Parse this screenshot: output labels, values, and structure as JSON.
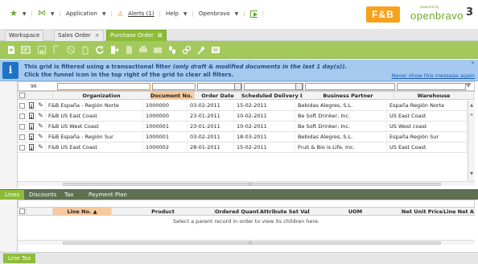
{
  "topnav": {
    "application": "Application",
    "alerts": "Alerts (1)",
    "help": "Help",
    "user": "Openbravo"
  },
  "logo": {
    "fb": "F&B",
    "powered": "powered by",
    "name": "openbravo",
    "version": "3"
  },
  "tabs": [
    {
      "label": "Workspace",
      "closable": false,
      "active": false
    },
    {
      "label": "Sales Order",
      "closable": true,
      "active": false
    },
    {
      "label": "Purchase Order",
      "closable": true,
      "active": true
    }
  ],
  "message": {
    "text_before": "This grid is filtered using a transactional filter ",
    "text_italic": "(only draft & modified documents in the last 1 day(s)).",
    "line2": "Click the funnel icon in the top right of the grid to clear all filters.",
    "link": "Never show this message again",
    "close": "×"
  },
  "filter": {
    "count": "96"
  },
  "grid": {
    "columns": [
      "Organization",
      "Document No. ▲",
      "Order Date",
      "Scheduled Delivery Date",
      "Business Partner",
      "Warehouse"
    ],
    "rows": [
      [
        "F&B España - Región Norte",
        "1000000",
        "03-02-2011",
        "15-02-2011",
        "Bebidas Alegres, S.L.",
        "España Región Norte"
      ],
      [
        "F&B US East Coast",
        "1000000",
        "23-01-2011",
        "10-02-2011",
        "Be Soft Drinker, Inc.",
        "US East Coast"
      ],
      [
        "F&B US West Coast",
        "1000001",
        "23-01-2011",
        "10-02-2011",
        "Be Soft Drinker, Inc.",
        "US West coast"
      ],
      [
        "F&B España - Región Sur",
        "1000001",
        "03-02-2011",
        "18-03-2011",
        "Bebidas Alegres, S.L.",
        "España Región Sur"
      ],
      [
        "F&B US East Coast",
        "1000002",
        "28-01-2011",
        "15-02-2011",
        "Fruit & Bio is Life, Inc.",
        "US East Coast"
      ]
    ]
  },
  "child_tabs": [
    {
      "label": "Lines",
      "active": true
    },
    {
      "label": "Discounts",
      "active": false
    },
    {
      "label": "Tax",
      "active": false
    },
    {
      "label": "Payment Plan",
      "active": false
    }
  ],
  "lines_grid": {
    "columns": [
      "Line No. ▲",
      "Product",
      "Ordered Quantity",
      "Attribute Set Value",
      "UOM",
      "Net Unit Price",
      "Line Net Amou"
    ],
    "empty_message": "Select a parent record in order to view its children here."
  },
  "bottom_tab": "Line Tax",
  "colors": {
    "accent": "#8cbc38",
    "toolbar": "#a3c95c",
    "info": "#a6c9ef",
    "sorted": "#f6c99e"
  }
}
